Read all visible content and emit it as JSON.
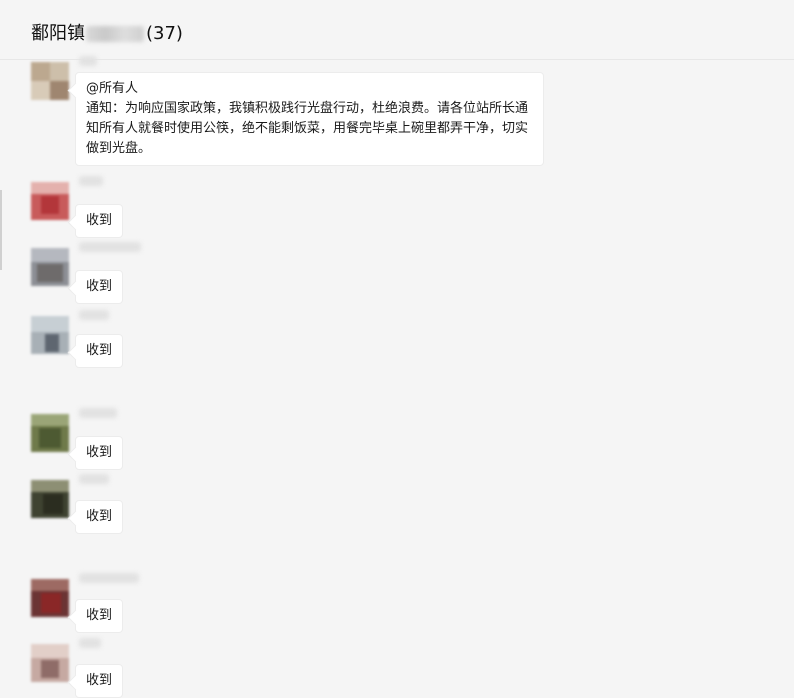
{
  "chat": {
    "title_prefix": "鄱阳镇",
    "member_count": "(37)"
  },
  "messages": [
    {
      "mention": "@所有人",
      "text": "通知：为响应国家政策，我镇积极践行光盘行动，杜绝浪费。请各位站所长通知所有人就餐时使用公筷，绝不能剩饭菜，用餐完毕桌上碗里都弄干净，切实做到光盘。"
    },
    {
      "text": "收到"
    },
    {
      "text": "收到"
    },
    {
      "text": "收到"
    },
    {
      "text": "收到"
    },
    {
      "text": "收到"
    },
    {
      "text": "收到"
    },
    {
      "text": "收到"
    }
  ],
  "colors": {
    "background": "#f5f5f5",
    "bubble": "#ffffff",
    "text": "#1a1a1a"
  }
}
